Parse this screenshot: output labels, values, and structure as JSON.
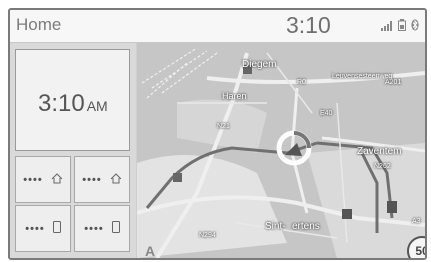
{
  "header": {
    "title": "Home",
    "time": "3:10",
    "icons": [
      "signal-icon",
      "battery-icon",
      "bluetooth-icon"
    ]
  },
  "clock_card": {
    "time": "3:10",
    "ampm": "AM"
  },
  "favorites": [
    {
      "label": "••••",
      "icon": "home-icon"
    },
    {
      "label": "••••",
      "icon": "home-icon"
    },
    {
      "label": "••••",
      "icon": "phone-icon"
    },
    {
      "label": "••••",
      "icon": "phone-icon"
    }
  ],
  "map": {
    "labels": {
      "diegem": "Diegem",
      "haren": "Haren",
      "zaventem": "Zaventem",
      "sint": "Sint-",
      "ertens": "ertens",
      "r0": "R0",
      "a201": "A201",
      "n21": "N21",
      "n294": "N294",
      "n262": "N262",
      "a3": "A3",
      "e40": "E40",
      "leuvense": "Leuvensesteenweg"
    },
    "compass": "A",
    "speed_limit": "50"
  }
}
